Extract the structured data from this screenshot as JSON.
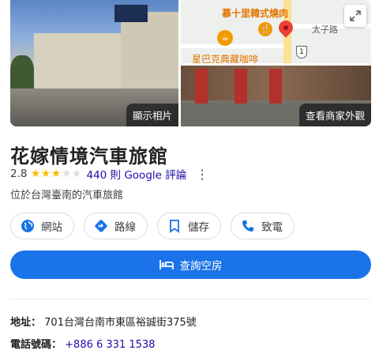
{
  "photos": {
    "main_label": "顯示相片",
    "exterior_label": "查看商家外觀"
  },
  "map": {
    "poi_restaurant": "慕十里韓式燒肉",
    "poi_cafe": "星巴克典藏咖啡",
    "road_name": "太子路",
    "route_number": "1"
  },
  "place": {
    "title": "花嫁情境汽車旅館",
    "rating": "2.8",
    "stars_filled": 3,
    "stars_total": 5,
    "reviews_text": "440 則 Google 評論",
    "category": "位於台灣臺南的汽車旅館"
  },
  "actions": [
    {
      "label": "網站",
      "icon": "globe-icon"
    },
    {
      "label": "路線",
      "icon": "directions-icon"
    },
    {
      "label": "儲存",
      "icon": "bookmark-icon"
    },
    {
      "label": "致電",
      "icon": "phone-icon"
    }
  ],
  "primary_action": {
    "label": "查詢空房",
    "icon": "bed-icon"
  },
  "info": {
    "address_label": "地址：",
    "address_value": "701台灣台南市東區裕誠街375號",
    "phone_label": "電話號碼：",
    "phone_value": "+886 6 331 1538"
  },
  "colors": {
    "accent": "#1a73e8",
    "star": "#fbbc04",
    "link": "#1a0dab"
  }
}
